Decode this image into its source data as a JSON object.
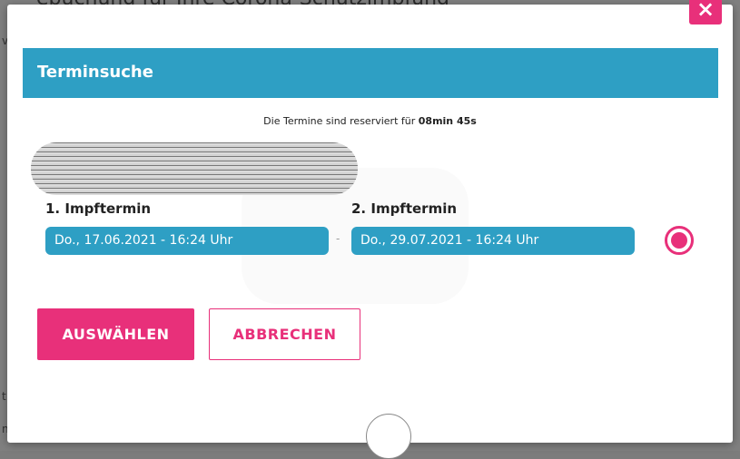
{
  "background": {
    "page_title": "ebuchung für Ihre Corona-Schutzimpfung",
    "edge_chars": [
      "v",
      "t",
      "n"
    ]
  },
  "modal": {
    "close_icon": "×",
    "header_title": "Terminsuche",
    "reservation": {
      "prefix": "Die Termine sind reserviert für",
      "time": "08min 45s"
    },
    "appointments": [
      {
        "label": "1. Impftermin",
        "date": "Do., 17.06.2021 - 16:24 Uhr"
      },
      {
        "label": "2. Impftermin",
        "date": "Do., 29.07.2021 - 16:24 Uhr"
      }
    ],
    "separator": "-",
    "buttons": {
      "select": "AUSWÄHLEN",
      "cancel": "ABBRECHEN"
    }
  },
  "colors": {
    "accent_pink": "#e8307a",
    "header_blue": "#2e9fc4"
  }
}
